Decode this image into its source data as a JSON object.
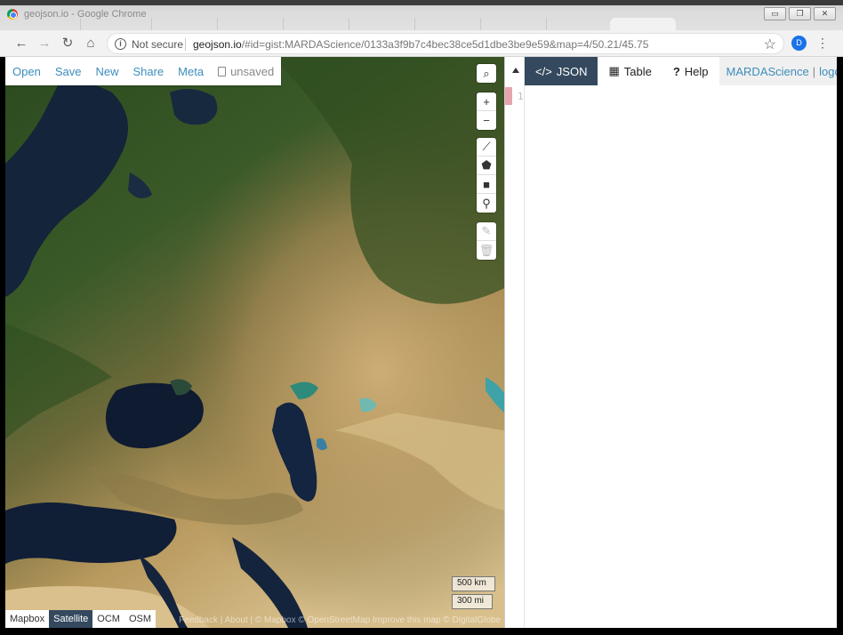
{
  "window": {
    "title": "geojson.io - Google Chrome"
  },
  "browser": {
    "security": "Not secure",
    "url_host": "geojson.io",
    "url_path": "/#id=gist:MARDAScience/0133a3f9b7c4bec38ce5d1dbe3be9e59&map=4/50.21/45.75",
    "avatar_letter": "D"
  },
  "app_nav": {
    "open": "Open",
    "save": "Save",
    "new": "New",
    "share": "Share",
    "meta": "Meta",
    "file_status": "unsaved"
  },
  "map": {
    "scale_km": "500 km",
    "scale_mi": "300 mi",
    "layers": [
      "Mapbox",
      "Satellite",
      "OCM",
      "OSM"
    ],
    "active_layer": "Satellite",
    "attribution": "Feedback | About | © Mapbox © OpenStreetMap Improve this map © DigitalGlobe"
  },
  "panel": {
    "tabs": {
      "json": "JSON",
      "table": "Table",
      "help": "Help"
    },
    "active_tab": "JSON",
    "user": "MARDAScience",
    "logout": "logout",
    "line_number": "1"
  },
  "colors": {
    "accent": "#34495e",
    "link": "#3c8dbc"
  }
}
